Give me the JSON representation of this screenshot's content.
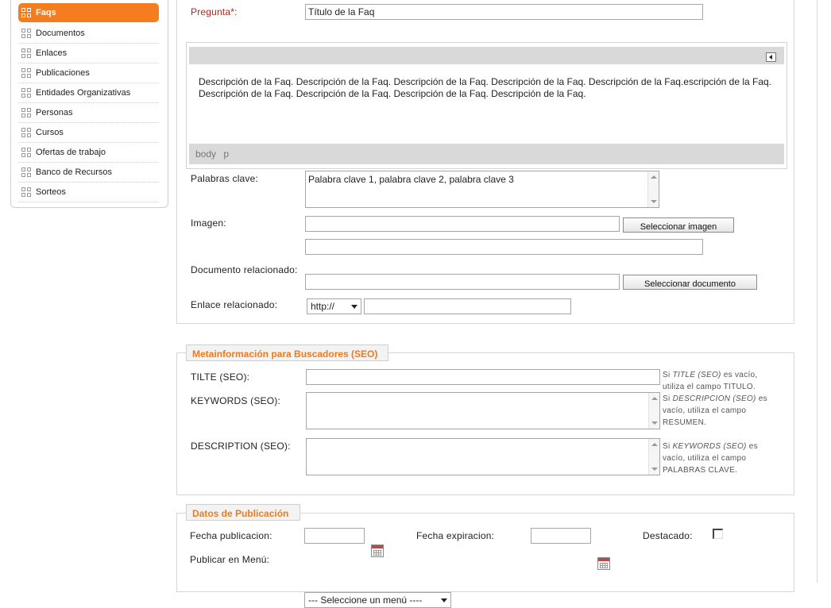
{
  "sidebar": {
    "items": [
      {
        "label": "Faqs",
        "active": true
      },
      {
        "label": "Documentos"
      },
      {
        "label": "Enlaces"
      },
      {
        "label": "Publicaciones"
      },
      {
        "label": "Entidades Organizativas"
      },
      {
        "label": "Personas"
      },
      {
        "label": "Cursos"
      },
      {
        "label": "Ofertas de trabajo"
      },
      {
        "label": "Banco de Recursos"
      },
      {
        "label": "Sorteos"
      }
    ]
  },
  "form": {
    "pregunta_label": "Pregunta*:",
    "pregunta_value": "Título de la Faq",
    "editor_text": "Descripción de la Faq.   Descripción de la Faq. Descripción de la Faq. Descripción de la Faq. Descripción de la Faq.escripción de la Faq.   Descripción de la Faq. Descripción de la Faq. Descripción de la Faq. Descripción de la Faq.",
    "editor_status": "body p",
    "palabras_label": "Palabras clave:",
    "palabras_value": "Palabra clave 1, palabra clave 2, palabra clave 3",
    "imagen_label": "Imagen:",
    "imagen_value": "",
    "imagen_button": "Seleccionar imagen",
    "imagen_extra_value": "",
    "documento_label": "Documento relacionado:",
    "documento_value": "",
    "documento_button": "Seleccionar documento",
    "enlace_label": "Enlace relacionado:",
    "enlace_protocol": "http://",
    "enlace_value": ""
  },
  "seo": {
    "legend": "Metainformación para Buscadores (SEO)",
    "title_label": "TILTE (SEO):",
    "title_value": "",
    "title_hint_pre": "Si ",
    "title_hint_em": "TITLE (SEO)",
    "title_hint_post": " es vacío,",
    "title_hint_2": "utiliza el campo TITULO.",
    "keywords_label": "KEYWORDS (SEO):",
    "keywords_value": "",
    "keywords_hint_pre": "Si ",
    "keywords_hint_em": "DESCRIPCION (SEO)",
    "keywords_hint_post": " es",
    "keywords_hint_2": "vacío, utiliza el campo",
    "keywords_hint_3": "RESUMEN.",
    "description_label": "DESCRIPTION (SEO):",
    "description_value": "",
    "description_hint_pre": "Si ",
    "description_hint_em": "KEYWORDS (SEO)",
    "description_hint_post": " es",
    "description_hint_2": "vacío, utiliza el campo",
    "description_hint_3": "PALABRAS CLAVE."
  },
  "publicacion": {
    "legend": "Datos de Publicación",
    "fecha_pub_label": "Fecha publicacion:",
    "fecha_pub_value": "",
    "fecha_exp_label": "Fecha expiracion:",
    "fecha_exp_value": "",
    "destacado_label": "Destacado:",
    "destacado_checked": false,
    "menu_label": "Publicar en Menú:",
    "menu_value": "--- Seleccione un menú ----"
  },
  "colors": {
    "accent": "#f57d1f",
    "required": "#b3261e"
  }
}
